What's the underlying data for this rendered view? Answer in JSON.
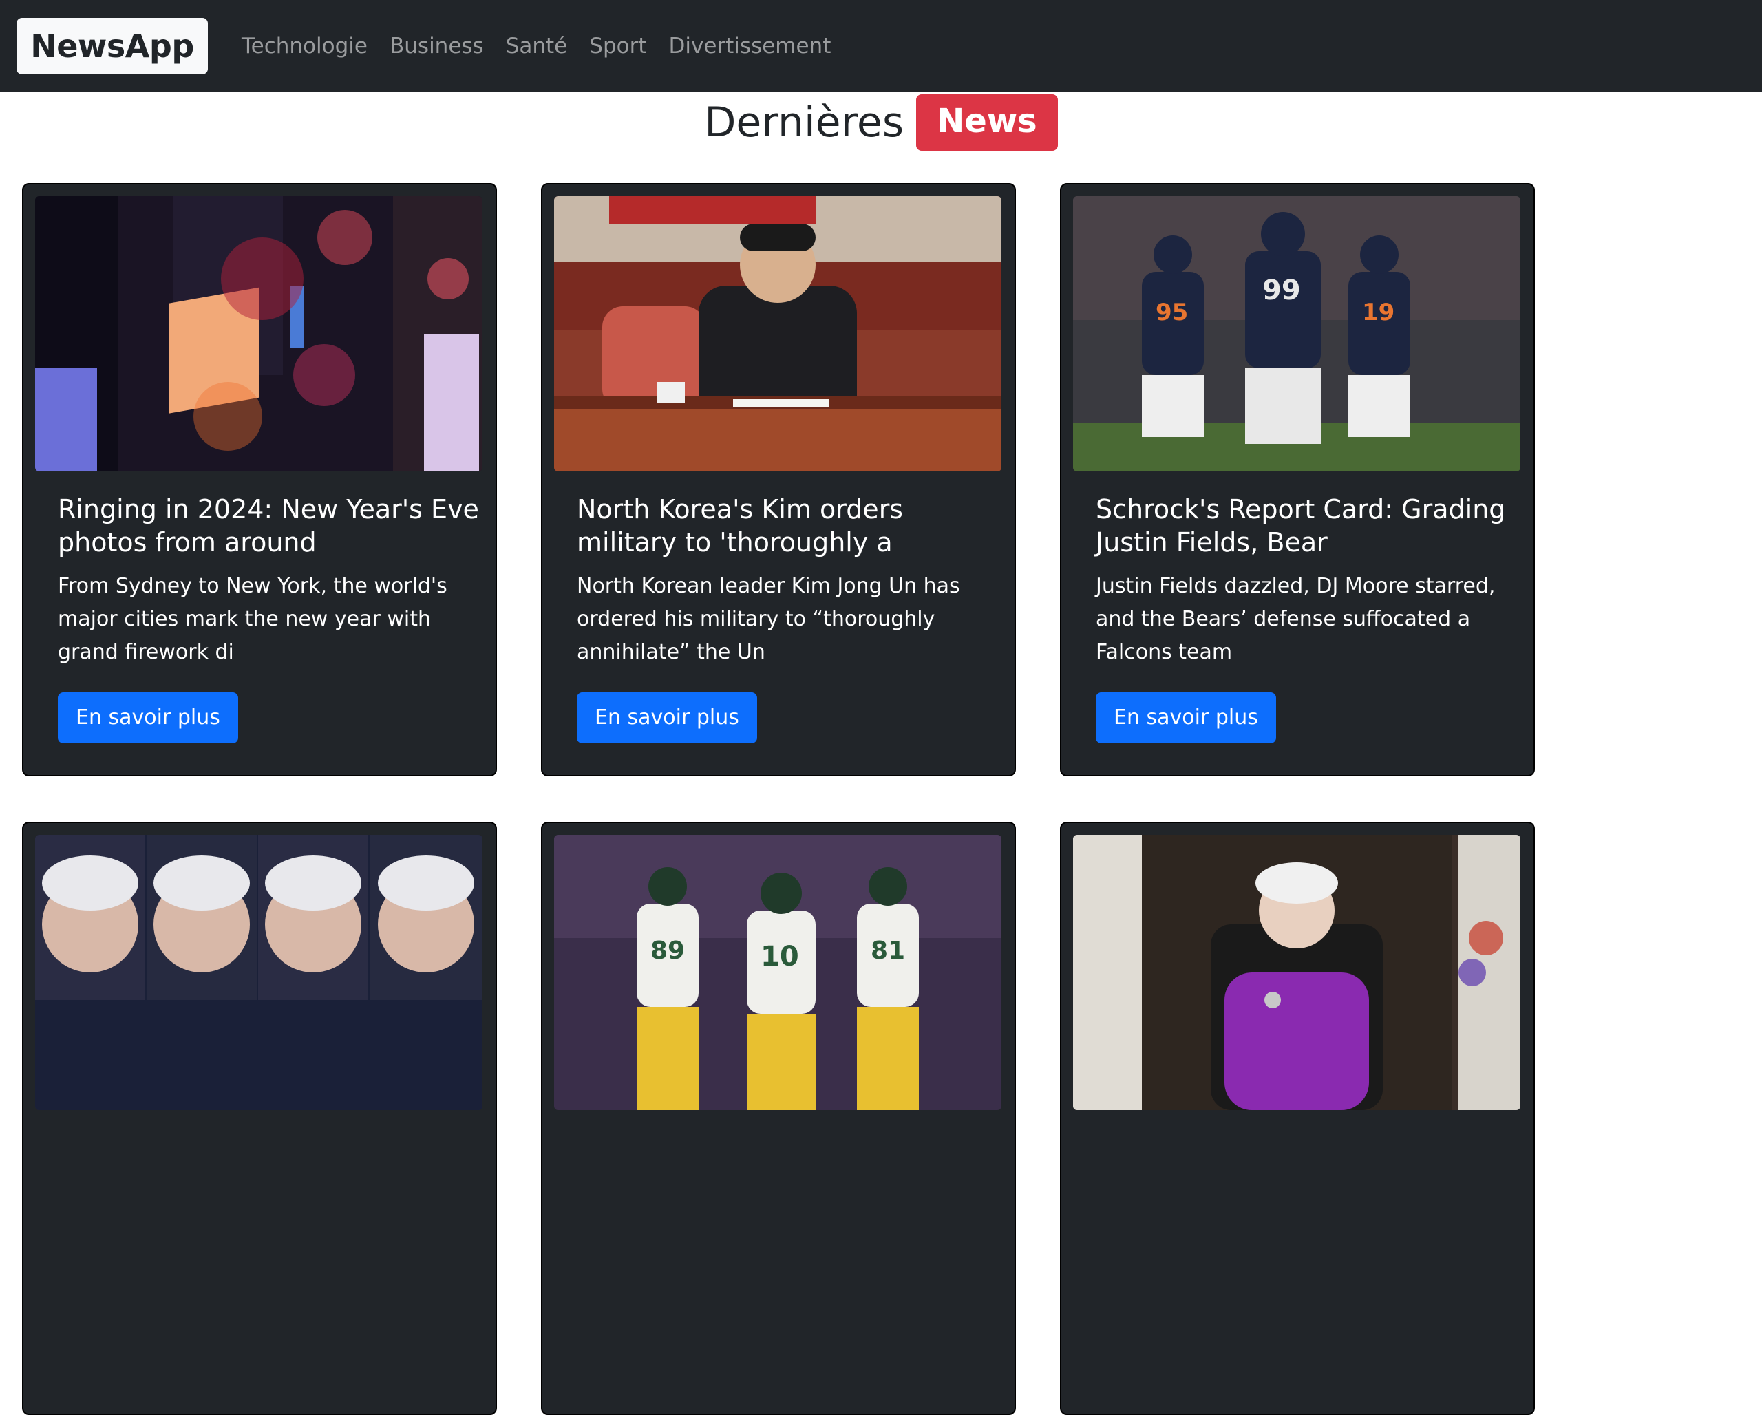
{
  "navbar": {
    "brand": "NewsApp",
    "links": [
      "Technologie",
      "Business",
      "Santé",
      "Sport",
      "Divertissement"
    ]
  },
  "heading": {
    "text": "Dernières",
    "badge": "News"
  },
  "cards": [
    {
      "title": "Ringing in 2024: New Year's Eve photos from around",
      "description": "From Sydney to New York, the world's major cities mark the new year with grand firework di",
      "button": "En savoir plus",
      "image": "new-years-eve-times-square-image"
    },
    {
      "title": "North Korea's Kim orders military to 'thoroughly a",
      "description": "North Korean leader Kim Jong Un has ordered his military to “thoroughly annihilate” the Un",
      "button": "En savoir plus",
      "image": "kim-jong-un-meeting-image"
    },
    {
      "title": "Schrock's Report Card: Grading Justin Fields, Bear",
      "description": "Justin Fields dazzled, DJ Moore starred, and the Bears’ defense suffocated a Falcons team",
      "button": "En savoir plus",
      "image": "chicago-bears-players-image"
    },
    {
      "title": "",
      "description": "",
      "button": "",
      "image": "anderson-cooper-collage-image"
    },
    {
      "title": "",
      "description": "",
      "button": "",
      "image": "green-bay-packers-players-image"
    },
    {
      "title": "",
      "description": "",
      "button": "",
      "image": "queen-margrethe-address-image"
    }
  ],
  "colors": {
    "navbar_bg": "#212529",
    "card_bg": "#212529",
    "badge": "#dc3545",
    "button": "#0d6efd"
  }
}
